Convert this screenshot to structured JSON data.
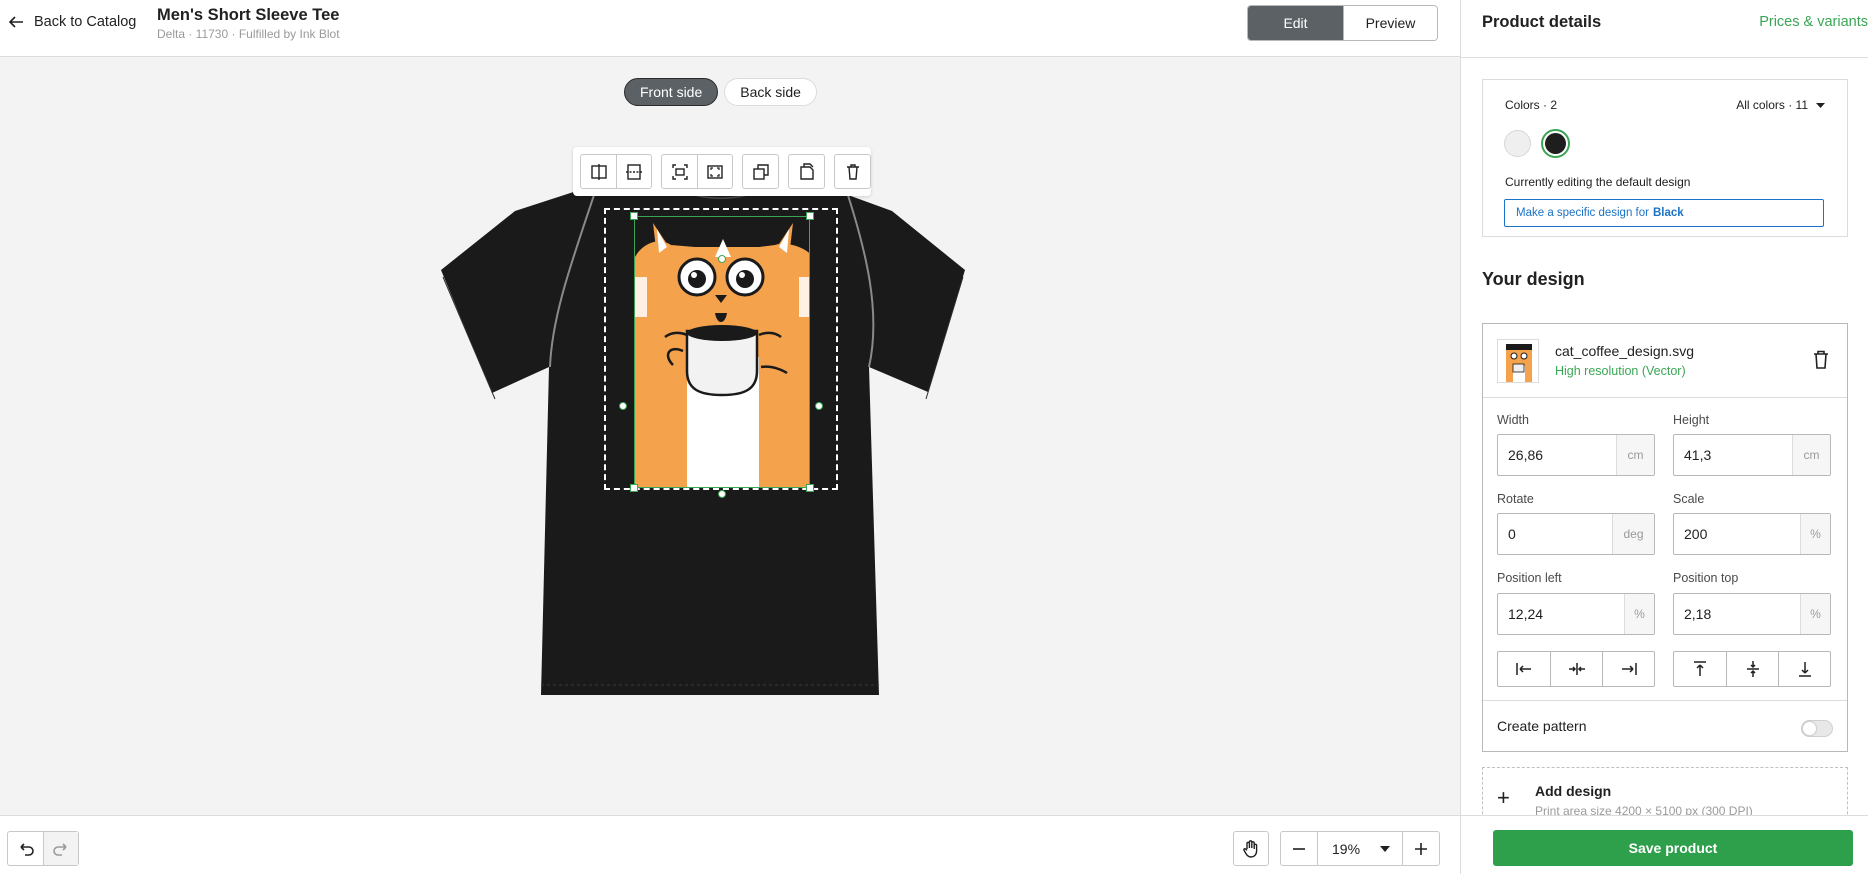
{
  "header": {
    "back_label": "Back to Catalog",
    "product_title": "Men's Short Sleeve Tee",
    "product_subtitle": "Delta · 11730 · Fulfilled by Ink Blot",
    "edit_label": "Edit",
    "preview_label": "Preview"
  },
  "canvas": {
    "front_tab": "Front side",
    "back_tab": "Back side",
    "active_side": "Front side",
    "toolbar_icons": [
      "flip-horizontal-icon",
      "flip-vertical-icon",
      "fit-to-area-icon",
      "fill-area-icon",
      "bring-forward-icon",
      "duplicate-icon",
      "delete-icon"
    ],
    "shirt_color": "#1a1a1a"
  },
  "bottom": {
    "zoom": "19%"
  },
  "panel": {
    "title": "Product details",
    "prices_link": "Prices & variants",
    "colors_label": "Colors · 2",
    "colors_select": "All colors · 11",
    "swatches": [
      {
        "name": "White",
        "hex": "#efefef"
      },
      {
        "name": "Black",
        "hex": "#1e1e1e",
        "selected": true
      }
    ],
    "editing_note": "Currently editing the default design",
    "specific_design_prefix": "Make a specific design for",
    "specific_design_color": "Black",
    "your_design_heading": "Your design",
    "file_name": "cat_coffee_design.svg",
    "file_resolution": "High resolution (Vector)",
    "fields": {
      "width_label": "Width",
      "width_value": "26,86",
      "width_unit": "cm",
      "height_label": "Height",
      "height_value": "41,3",
      "height_unit": "cm",
      "rotate_label": "Rotate",
      "rotate_value": "0",
      "rotate_unit": "deg",
      "scale_label": "Scale",
      "scale_value": "200",
      "scale_unit": "%",
      "pos_left_label": "Position left",
      "pos_left_value": "12,24",
      "pos_left_unit": "%",
      "pos_top_label": "Position top",
      "pos_top_value": "2,18",
      "pos_top_unit": "%"
    },
    "create_pattern_label": "Create pattern",
    "create_pattern_on": false,
    "add_design_title": "Add design",
    "add_design_sub": "Print area size 4200 × 5100 px (300 DPI)",
    "save_label": "Save product"
  },
  "colors": {
    "accent": "#3aa655",
    "save_button": "#2e9f4b",
    "link_blue": "#1a73c7",
    "toggle_active": "#5b6164"
  }
}
